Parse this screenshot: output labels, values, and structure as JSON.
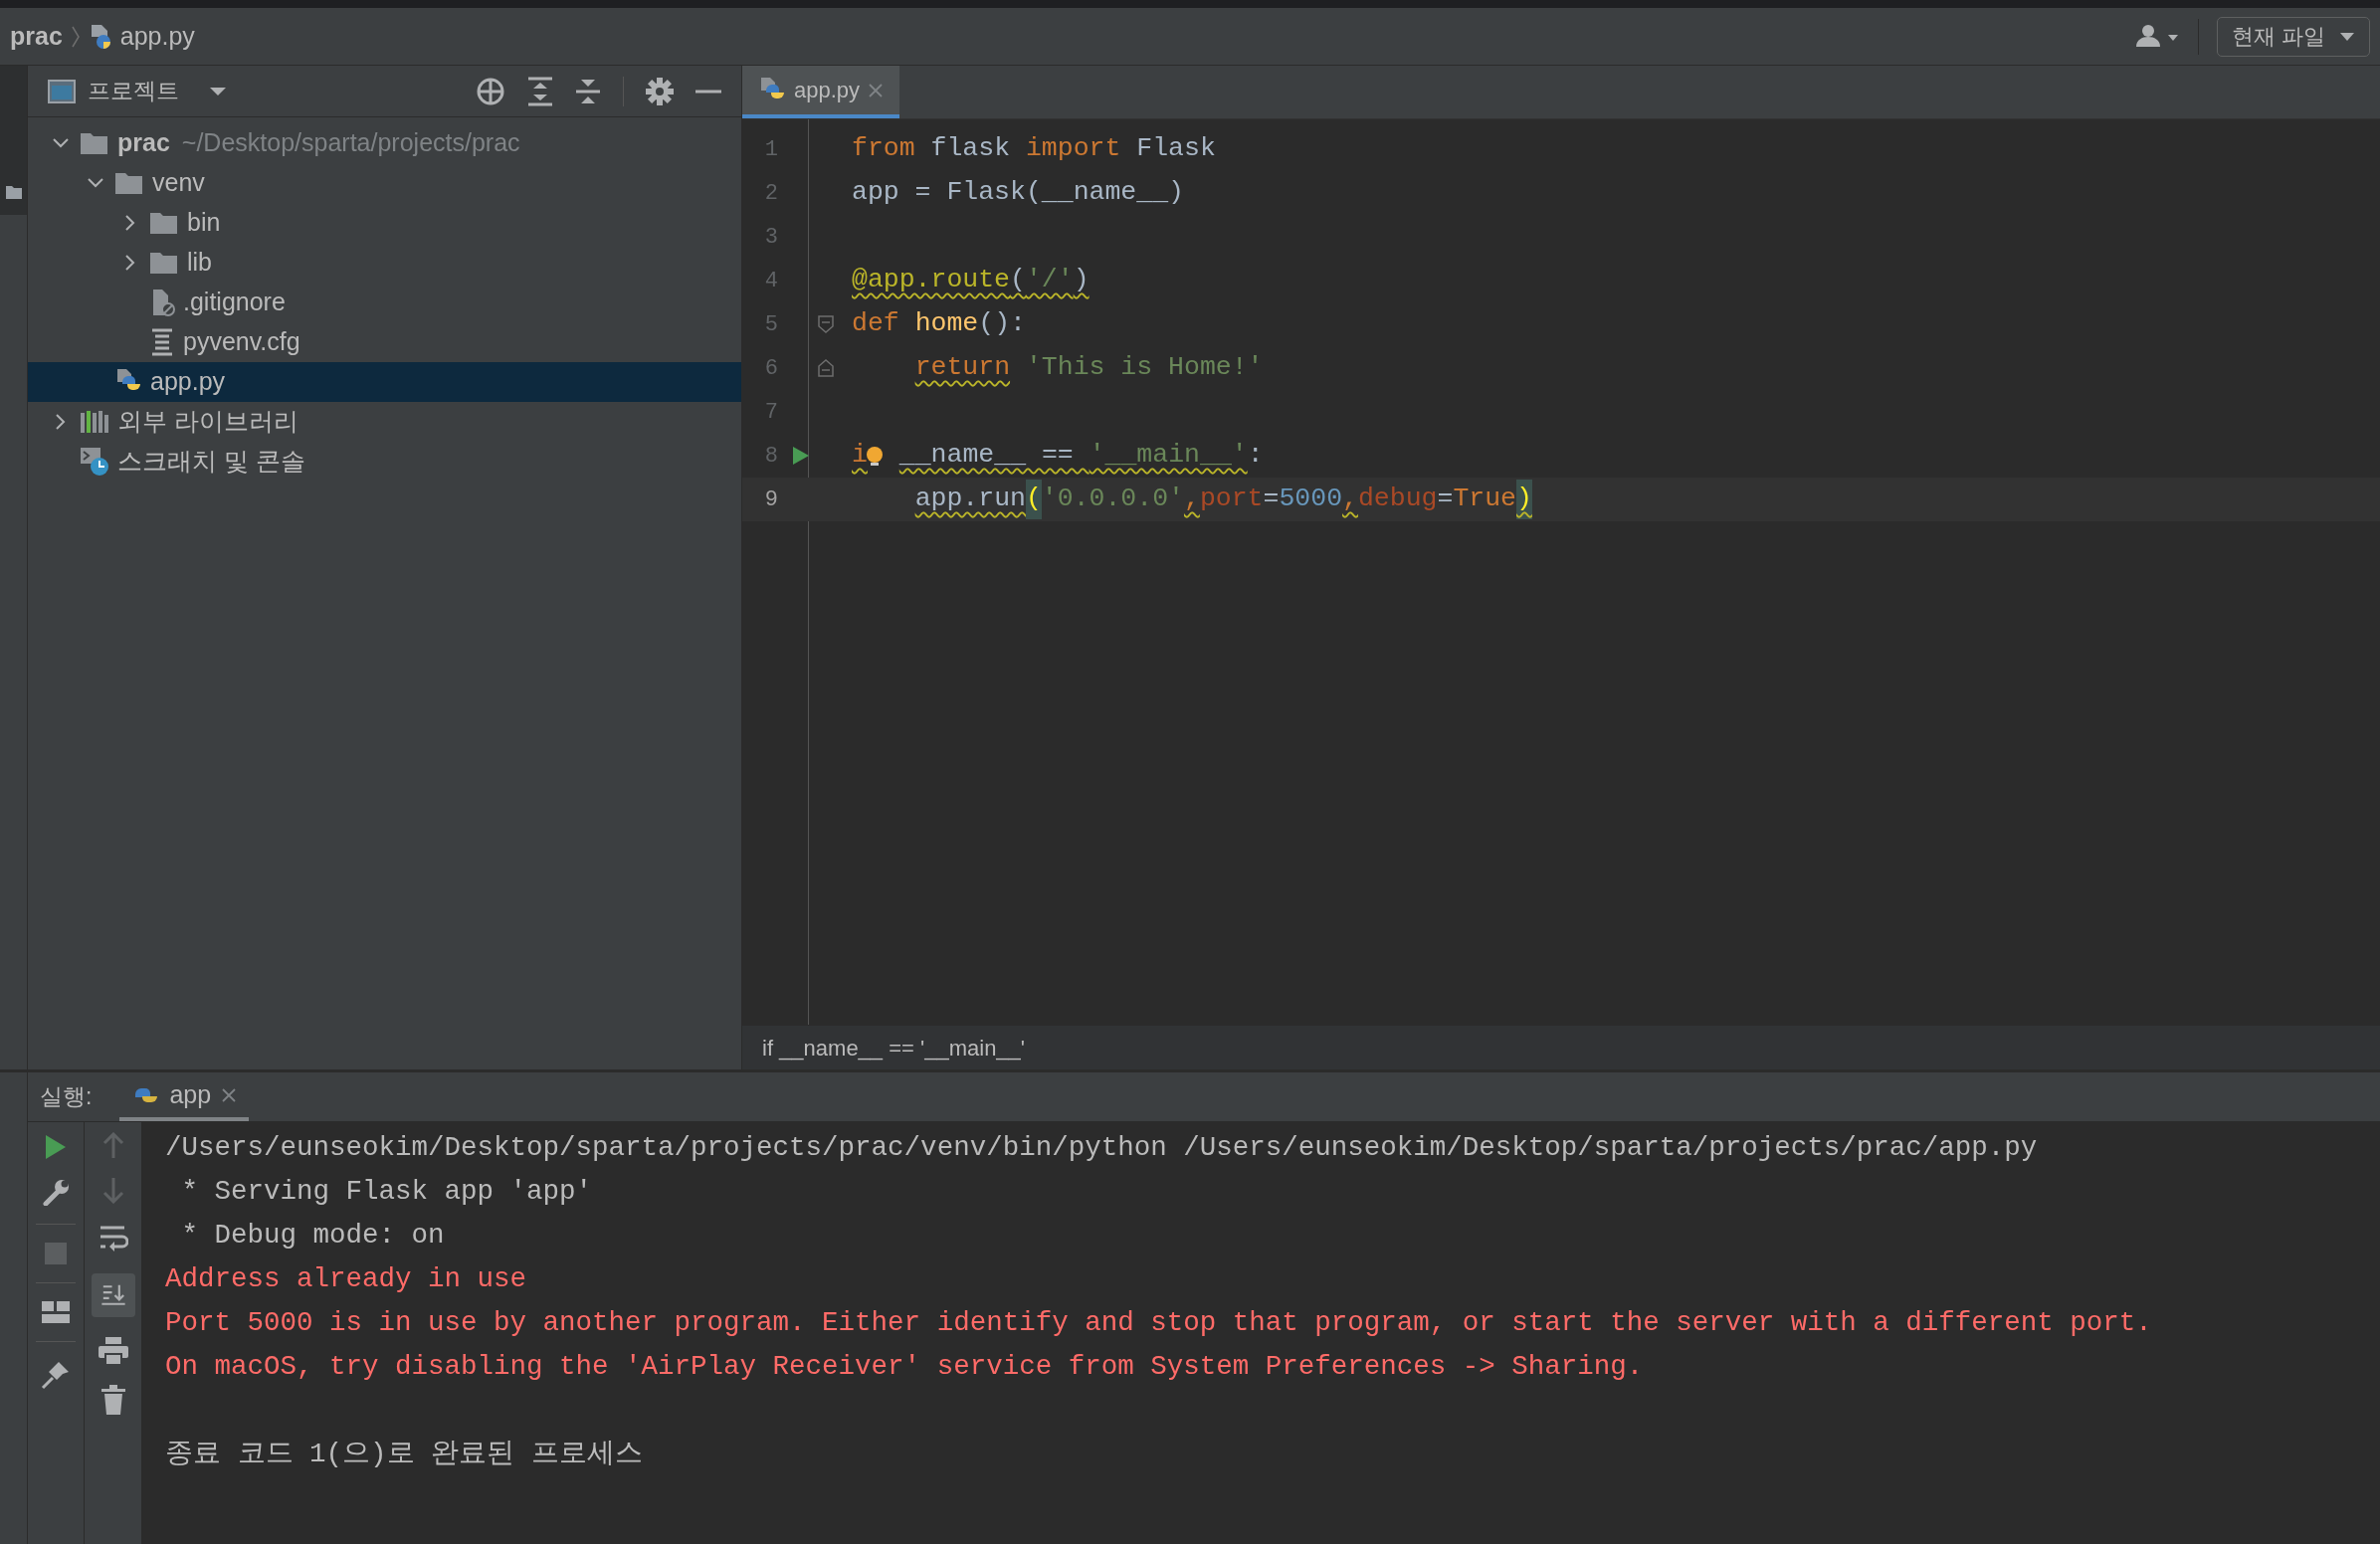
{
  "navbar": {
    "project": "prac",
    "file": "app.py",
    "scope": "현재 파일"
  },
  "project_panel": {
    "title": "프로젝트",
    "tree": [
      {
        "label": "prac",
        "kind": "folder",
        "path": "~/Desktop/sparta/projects/prac",
        "expanded": true,
        "selected": false,
        "children": [
          {
            "label": "venv",
            "kind": "folder",
            "expanded": true,
            "selected": false,
            "children": [
              {
                "label": "bin",
                "kind": "folder",
                "expanded": false,
                "selected": false
              },
              {
                "label": "lib",
                "kind": "folder",
                "expanded": false,
                "selected": false
              },
              {
                "label": ".gitignore",
                "kind": "ignore",
                "selected": false
              },
              {
                "label": "pyvenv.cfg",
                "kind": "config",
                "selected": false
              }
            ]
          },
          {
            "label": "app.py",
            "kind": "python",
            "selected": true
          }
        ]
      },
      {
        "label": "외부 라이브러리",
        "kind": "library",
        "expanded": false,
        "selected": false
      },
      {
        "label": "스크래치 및 콘솔",
        "kind": "scratch",
        "selected": false
      }
    ]
  },
  "editor": {
    "tabs": [
      {
        "label": "app.py",
        "selected": true
      }
    ],
    "lines": [
      {
        "number": "1",
        "tokens": [
          {
            "text": "from",
            "kind": "keyword"
          },
          {
            "text": " flask ",
            "kind": "plain"
          },
          {
            "text": "import",
            "kind": "keyword"
          },
          {
            "text": " Flask",
            "kind": "plain"
          }
        ]
      },
      {
        "number": "2",
        "tokens": [
          {
            "text": "app = Flask(__name__)",
            "kind": "plain"
          }
        ]
      },
      {
        "number": "3"
      },
      {
        "number": "4",
        "tokens": [
          {
            "text": "@app.route",
            "kind": "decorator",
            "warn": true
          },
          {
            "text": "(",
            "kind": "plain",
            "warn": true
          },
          {
            "text": "'/'",
            "kind": "string",
            "warn": true
          },
          {
            "text": ")",
            "kind": "plain",
            "warn": true
          }
        ]
      },
      {
        "number": "5",
        "fold_start": true,
        "tokens": [
          {
            "text": "def ",
            "kind": "keyword"
          },
          {
            "text": "home",
            "kind": "function"
          },
          {
            "text": "():",
            "kind": "plain"
          }
        ]
      },
      {
        "number": "6",
        "fold_end": true,
        "tokens": [
          {
            "text": "    return",
            "kind": "keyword",
            "warn": true
          },
          {
            "text": " 'This is Home!'",
            "kind": "string"
          }
        ]
      },
      {
        "number": "7"
      },
      {
        "number": "8",
        "run_marker": true,
        "intention": true,
        "tokens": [
          {
            "text": "i",
            "kind": "keyword",
            "warn": true
          },
          {
            "text": " __name__ == ",
            "kind": "plain",
            "warn": true
          },
          {
            "text": "'__main__'",
            "kind": "string",
            "warn": true
          },
          {
            "text": ":",
            "kind": "plain"
          }
        ]
      },
      {
        "number": "9",
        "current": true,
        "tokens": [
          {
            "text": "    app.run",
            "kind": "plain",
            "warn": true
          },
          {
            "text": "(",
            "kind": "brace"
          },
          {
            "text": "'0.0.0.0'",
            "kind": "string"
          },
          {
            "text": ",",
            "kind": "keyword",
            "warn": true
          },
          {
            "text": "port",
            "kind": "param"
          },
          {
            "text": "=",
            "kind": "plain"
          },
          {
            "text": "5000",
            "kind": "number"
          },
          {
            "text": ",",
            "kind": "keyword",
            "warn": true
          },
          {
            "text": "debug",
            "kind": "param"
          },
          {
            "text": "=",
            "kind": "plain"
          },
          {
            "text": "True",
            "kind": "keyword"
          },
          {
            "text": ")",
            "kind": "brace",
            "warn": true
          }
        ]
      }
    ],
    "breadcrumb": "if __name__ == '__main__'"
  },
  "run_panel": {
    "label": "실행:",
    "tabs": [
      {
        "label": "app",
        "selected": true
      }
    ],
    "output": [
      {
        "text": "/Users/eunseokim/Desktop/sparta/projects/prac/venv/bin/python /Users/eunseokim/Desktop/sparta/projects/prac/app.py",
        "kind": "normal"
      },
      {
        "text": " * Serving Flask app 'app'",
        "kind": "normal"
      },
      {
        "text": " * Debug mode: on",
        "kind": "normal"
      },
      {
        "text": "Address already in use",
        "kind": "error"
      },
      {
        "text": "Port 5000 is in use by another program. Either identify and stop that program, or start the server with a different port.",
        "kind": "error"
      },
      {
        "text": "On macOS, try disabling the 'AirPlay Receiver' service from System Preferences -> Sharing.",
        "kind": "error"
      },
      {
        "text": "종료 코드 1(으)로 완료된 프로세스",
        "kind": "exit"
      }
    ]
  }
}
